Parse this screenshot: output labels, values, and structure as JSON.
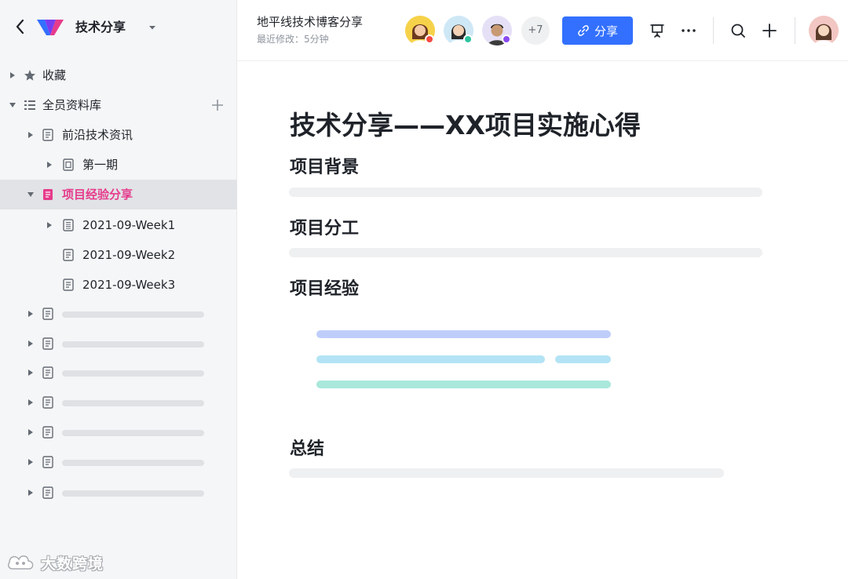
{
  "sidebar": {
    "space_title": "技术分享",
    "tree": {
      "favorites": "收藏",
      "library": "全员资料库",
      "frontier": "前沿技术资讯",
      "issue1": "第一期",
      "project": "项目经验分享",
      "week1": "2021-09-Week1",
      "week2": "2021-09-Week2",
      "week3": "2021-09-Week3"
    },
    "watermark": "大数跨境"
  },
  "topbar": {
    "doc_title": "地平线技术博客分享",
    "last_modified": "最近修改：5分钟",
    "more_collaborators": "+7",
    "share_label": "分享"
  },
  "document": {
    "title": "技术分享——XX项目实施心得",
    "sections": [
      "项目背景",
      "项目分工",
      "项目经验",
      "总结"
    ]
  },
  "colors": {
    "accent": "#3370ff",
    "active_item": "#e63b8c",
    "avatar_status_1": "#f54a45",
    "avatar_status_2": "#2ec4a0",
    "avatar_status_3": "#8a4af0",
    "experience_line_1": "#bfcdfa",
    "experience_line_2": "#b3e3f5",
    "experience_line_3": "#a9e8db"
  },
  "icons": [
    "back-icon",
    "logo-icon",
    "chevron-down-icon",
    "caret-right-icon",
    "caret-down-icon",
    "star-icon",
    "library-icon",
    "doc-icon",
    "add-icon",
    "link-icon",
    "presentation-icon",
    "more-icon",
    "search-icon",
    "plus-icon"
  ]
}
